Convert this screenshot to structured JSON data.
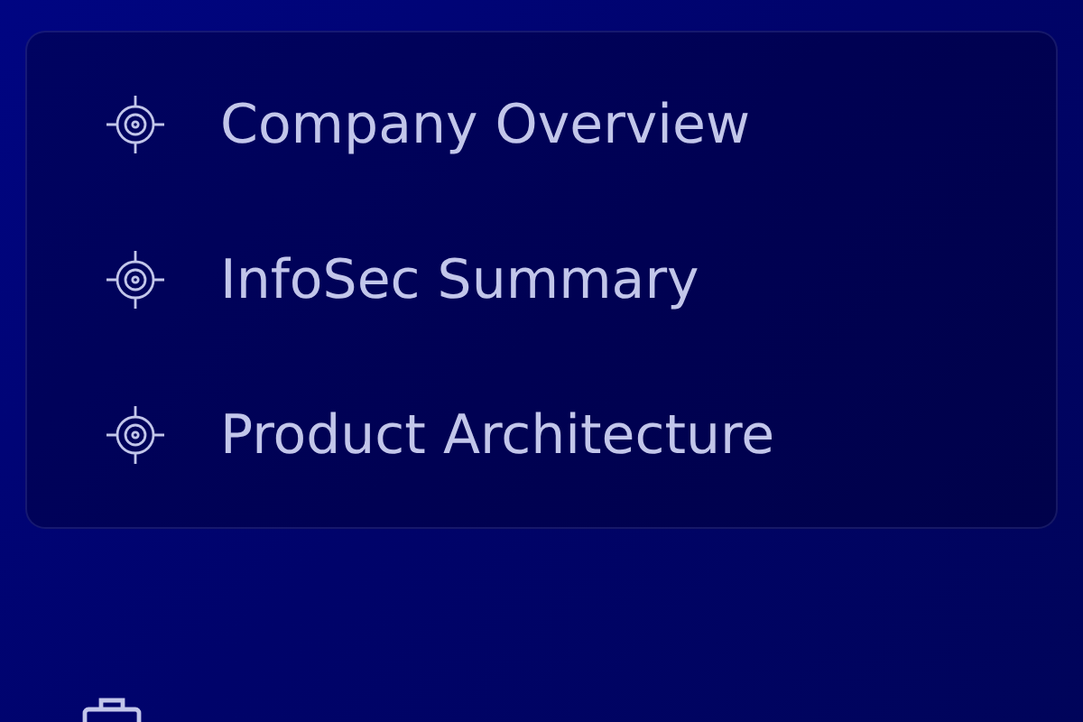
{
  "documents": [
    {
      "label": "Company Overview"
    },
    {
      "label": "InfoSec Summary"
    },
    {
      "label": "Product Architecture"
    }
  ]
}
